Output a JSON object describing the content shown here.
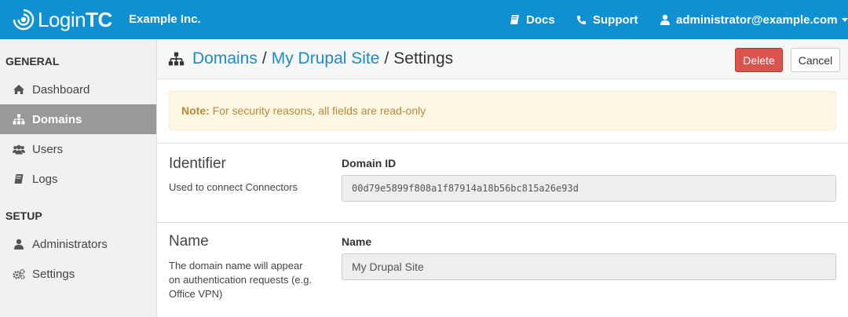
{
  "header": {
    "logo": {
      "text_light": "Login",
      "text_bold": "TC",
      "icon": "signal-waves-icon"
    },
    "org_name": "Example Inc.",
    "nav": {
      "docs": {
        "label": "Docs",
        "icon": "book-icon"
      },
      "support": {
        "label": "Support",
        "icon": "phone-icon"
      },
      "user": {
        "label": "administrator@example.com",
        "icon": "user-icon"
      }
    },
    "color": "#0e90d2"
  },
  "sidebar": {
    "sections": [
      {
        "heading": "GENERAL"
      },
      {
        "heading": "SETUP"
      }
    ],
    "items": [
      {
        "label": "Dashboard",
        "icon": "home-icon",
        "active": false
      },
      {
        "label": "Domains",
        "icon": "sitemap-icon",
        "active": true
      },
      {
        "label": "Users",
        "icon": "users-icon",
        "active": false
      },
      {
        "label": "Logs",
        "icon": "book-icon",
        "active": false
      },
      {
        "label": "Administrators",
        "icon": "user-icon",
        "active": false
      },
      {
        "label": "Settings",
        "icon": "gears-icon",
        "active": false
      }
    ]
  },
  "page": {
    "breadcrumb": {
      "icon": "sitemap-icon",
      "root": "Domains",
      "sep": "/",
      "domain": "My Drupal Site",
      "current": "Settings"
    },
    "buttons": {
      "delete": "Delete",
      "cancel": "Cancel"
    },
    "alert": {
      "strong": "Note:",
      "text": "For security reasons, all fields are read-only"
    },
    "sections": [
      {
        "title": "Identifier",
        "description": "Used to connect Connectors",
        "field_label": "Domain ID",
        "field_value": "00d79e5899f808a1f87914a18b56bc815a26e93d"
      },
      {
        "title": "Name",
        "description": "The domain name will appear on authentication requests (e.g. Office VPN)",
        "field_label": "Name",
        "field_value": "My Drupal Site"
      }
    ]
  },
  "colors": {
    "accent": "#0e90d2",
    "danger": "#d9534f",
    "alert_bg": "#fcf8e3",
    "link": "#1a8ccc"
  }
}
